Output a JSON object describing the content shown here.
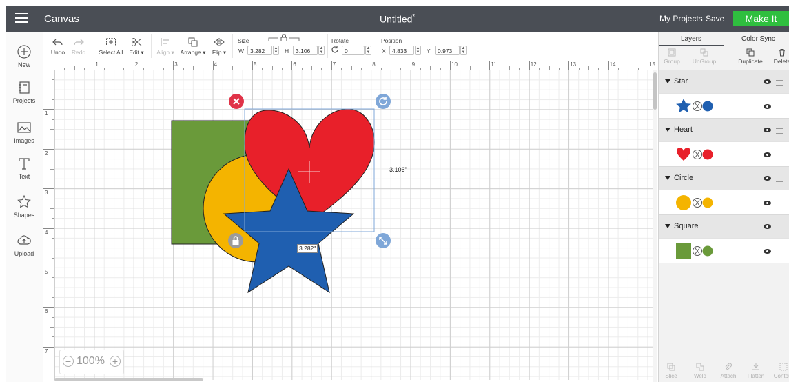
{
  "topbar": {
    "app_title": "Canvas",
    "doc_title": "Untitled",
    "doc_modified_marker": "*",
    "my_projects": "My Projects",
    "save": "Save",
    "make_it": "Make It"
  },
  "left_toolbar": {
    "items": [
      {
        "label": "New",
        "icon": "plus-circle-icon"
      },
      {
        "label": "Projects",
        "icon": "projects-icon"
      },
      {
        "label": "Images",
        "icon": "images-icon"
      },
      {
        "label": "Text",
        "icon": "text-icon"
      },
      {
        "label": "Shapes",
        "icon": "shapes-icon"
      },
      {
        "label": "Upload",
        "icon": "upload-cloud-icon"
      }
    ]
  },
  "property_toolbar": {
    "undo": "Undo",
    "redo": "Redo",
    "select_all": "Select All",
    "edit": "Edit",
    "align": "Align",
    "arrange": "Arrange",
    "flip": "Flip",
    "size_label": "Size",
    "w_label": "W",
    "w_value": "3.282",
    "h_label": "H",
    "h_value": "3.106",
    "rotate_label": "Rotate",
    "rotate_value": "0",
    "position_label": "Position",
    "x_label": "X",
    "x_value": "4.833",
    "y_label": "Y",
    "y_value": "0.973"
  },
  "ruler": {
    "horizontal": [
      "1",
      "2",
      "3",
      "4",
      "5",
      "6",
      "7",
      "8",
      "9",
      "10",
      "11",
      "12",
      "13",
      "14",
      "15"
    ],
    "vertical": [
      "1",
      "2",
      "3",
      "4",
      "5",
      "6",
      "7"
    ]
  },
  "canvas": {
    "height_dimension": "3.106\"",
    "width_dimension": "3.282\"",
    "shapes": [
      {
        "name": "Square",
        "color": "#6a9a3a"
      },
      {
        "name": "Circle",
        "color": "#f4b400"
      },
      {
        "name": "Heart",
        "color": "#e8202a"
      },
      {
        "name": "Star",
        "color": "#1f5fb0"
      }
    ],
    "zoom_value": "100%"
  },
  "layers_panel": {
    "tab_layers": "Layers",
    "tab_color_sync": "Color Sync",
    "group": "Group",
    "ungroup": "UnGroup",
    "duplicate": "Duplicate",
    "delete": "Delete",
    "layers": [
      {
        "name": "Star",
        "color": "#1f5fb0"
      },
      {
        "name": "Heart",
        "color": "#e8202a"
      },
      {
        "name": "Circle",
        "color": "#f4b400"
      },
      {
        "name": "Square",
        "color": "#6a9a3a"
      }
    ],
    "bottom_tools": [
      "Slice",
      "Weld",
      "Attach",
      "Flatten",
      "Contour"
    ]
  }
}
